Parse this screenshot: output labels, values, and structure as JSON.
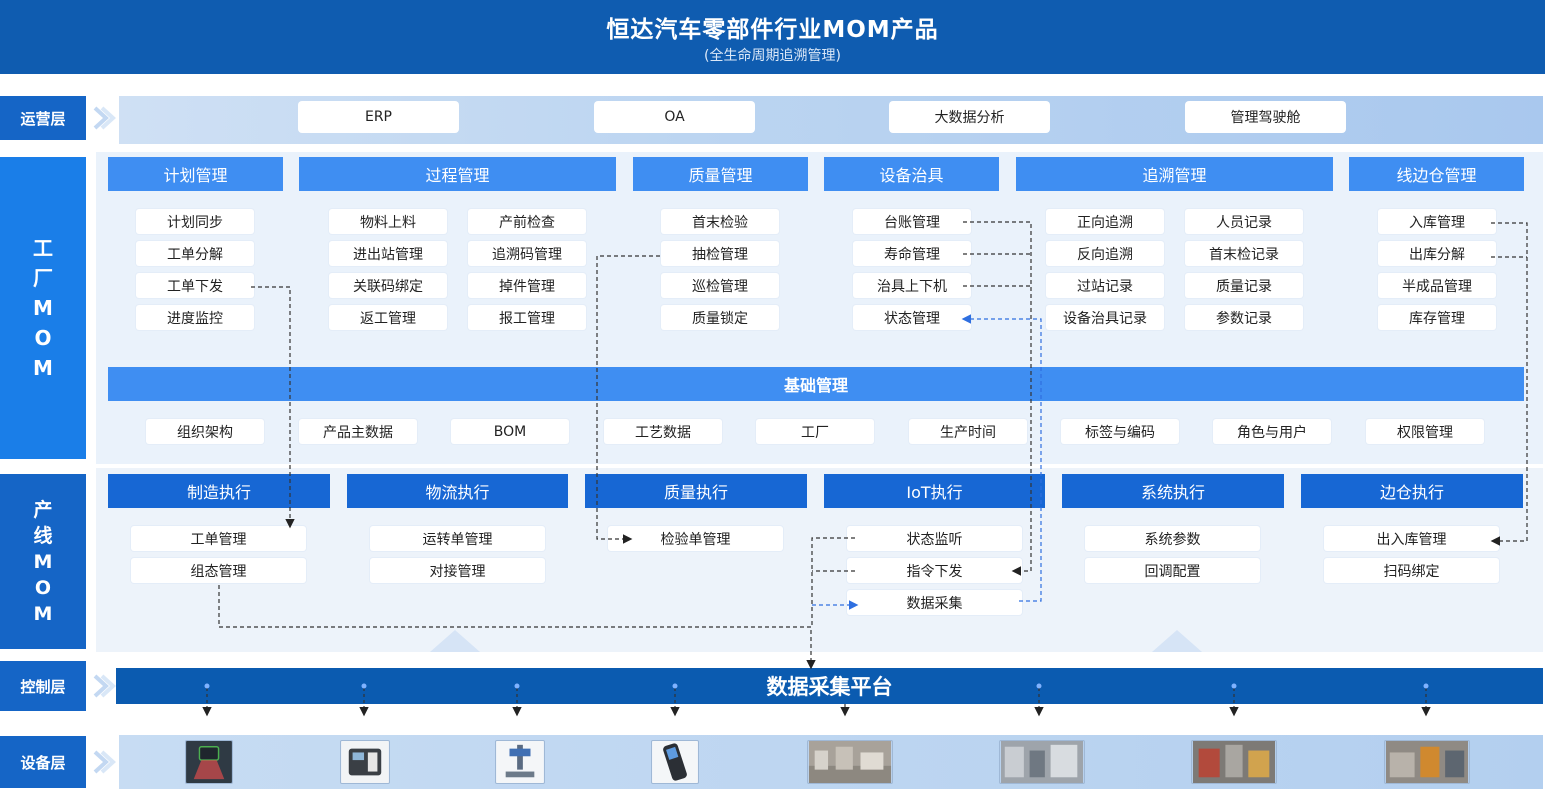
{
  "header": {
    "title": "恒达汽车零部件行业MOM产品",
    "subtitle": "(全生命周期追溯管理)"
  },
  "layers": {
    "ops": "运营层",
    "factory": [
      "工",
      "厂",
      "M",
      "O",
      "M"
    ],
    "line": [
      "产",
      "线",
      "M",
      "O",
      "M"
    ],
    "control": "控制层",
    "device": "设备层"
  },
  "ops_items": [
    "ERP",
    "OA",
    "大数据分析",
    "管理驾驶舱"
  ],
  "factory_modules": [
    {
      "title": "计划管理",
      "items": [
        "计划同步",
        "工单分解",
        "工单下发",
        "进度监控"
      ]
    },
    {
      "title": "过程管理",
      "items": [
        "物料上料",
        "产前检查",
        "进出站管理",
        "追溯码管理",
        "关联码绑定",
        "掉件管理",
        "返工管理",
        "报工管理"
      ]
    },
    {
      "title": "质量管理",
      "items": [
        "首末检验",
        "抽检管理",
        "巡检管理",
        "质量锁定"
      ]
    },
    {
      "title": "设备治具",
      "items": [
        "台账管理",
        "寿命管理",
        "治具上下机",
        "状态管理"
      ]
    },
    {
      "title": "追溯管理",
      "items": [
        "正向追溯",
        "人员记录",
        "反向追溯",
        "首末检记录",
        "过站记录",
        "质量记录",
        "设备治具记录",
        "参数记录"
      ]
    },
    {
      "title": "线边仓管理",
      "items": [
        "入库管理",
        "出库分解",
        "半成品管理",
        "库存管理"
      ]
    }
  ],
  "base": {
    "title": "基础管理",
    "items": [
      "组织架构",
      "产品主数据",
      "BOM",
      "工艺数据",
      "工厂",
      "生产时间",
      "标签与编码",
      "角色与用户",
      "权限管理"
    ]
  },
  "line_modules": [
    {
      "title": "制造执行",
      "items": [
        "工单管理",
        "组态管理"
      ]
    },
    {
      "title": "物流执行",
      "items": [
        "运转单管理",
        "对接管理"
      ]
    },
    {
      "title": "质量执行",
      "items": [
        "检验单管理"
      ]
    },
    {
      "title": "IoT执行",
      "items": [
        "状态监听",
        "指令下发",
        "数据采集"
      ]
    },
    {
      "title": "系统执行",
      "items": [
        "系统参数",
        "回调配置"
      ]
    },
    {
      "title": "边仓执行",
      "items": [
        "出入库管理",
        "扫码绑定"
      ]
    }
  ],
  "platform": "数据采集平台",
  "devices": [
    "scanner-light-icon",
    "label-printer-icon",
    "laser-marker-icon",
    "handheld-pda-icon",
    "workshop-photo-1",
    "workshop-photo-2",
    "workshop-photo-3",
    "workshop-photo-4"
  ],
  "colors": {
    "header": "#0f5cb0",
    "module": "#3f8ef2",
    "execution": "#1767d4",
    "platform": "#0b5bb0",
    "label": "#1565c6"
  }
}
